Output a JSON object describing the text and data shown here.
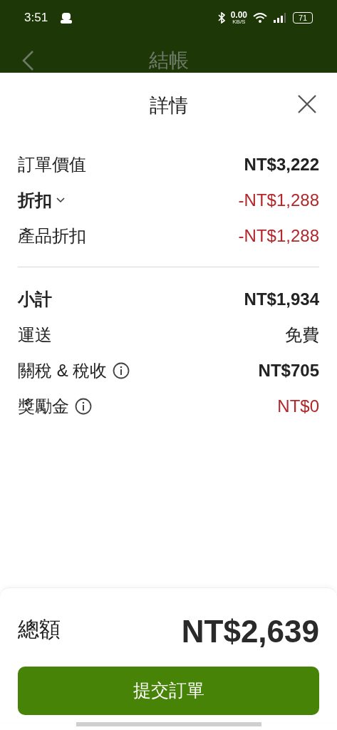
{
  "status_bar": {
    "time": "3:51",
    "net_speed": "0.00",
    "net_unit": "KB/S",
    "battery": "71"
  },
  "header": {
    "title": "結帳"
  },
  "sheet": {
    "title": "詳情",
    "groups": [
      {
        "rows": [
          {
            "label": "訂單價值",
            "value": "NT$3,222",
            "kind": "bold"
          },
          {
            "label": "折扣",
            "expandable": true,
            "value": "-NT$1,288",
            "kind": "discount",
            "label_bold": true
          },
          {
            "label": "產品折扣",
            "value": "-NT$1,288",
            "kind": "discount"
          }
        ]
      },
      {
        "rows": [
          {
            "label": "小計",
            "value": "NT$1,934",
            "kind": "bold",
            "label_bold": true
          },
          {
            "label": "運送",
            "value": "免費",
            "kind": "plain"
          },
          {
            "label": "關稅 & 稅收",
            "has_info": true,
            "value": "NT$705",
            "kind": "bold"
          },
          {
            "label": "獎勵金",
            "has_info": true,
            "value": "NT$0",
            "kind": "discount"
          }
        ]
      }
    ]
  },
  "footer": {
    "total_label": "總額",
    "total_value": "NT$2,639",
    "submit_button": "提交訂單"
  }
}
